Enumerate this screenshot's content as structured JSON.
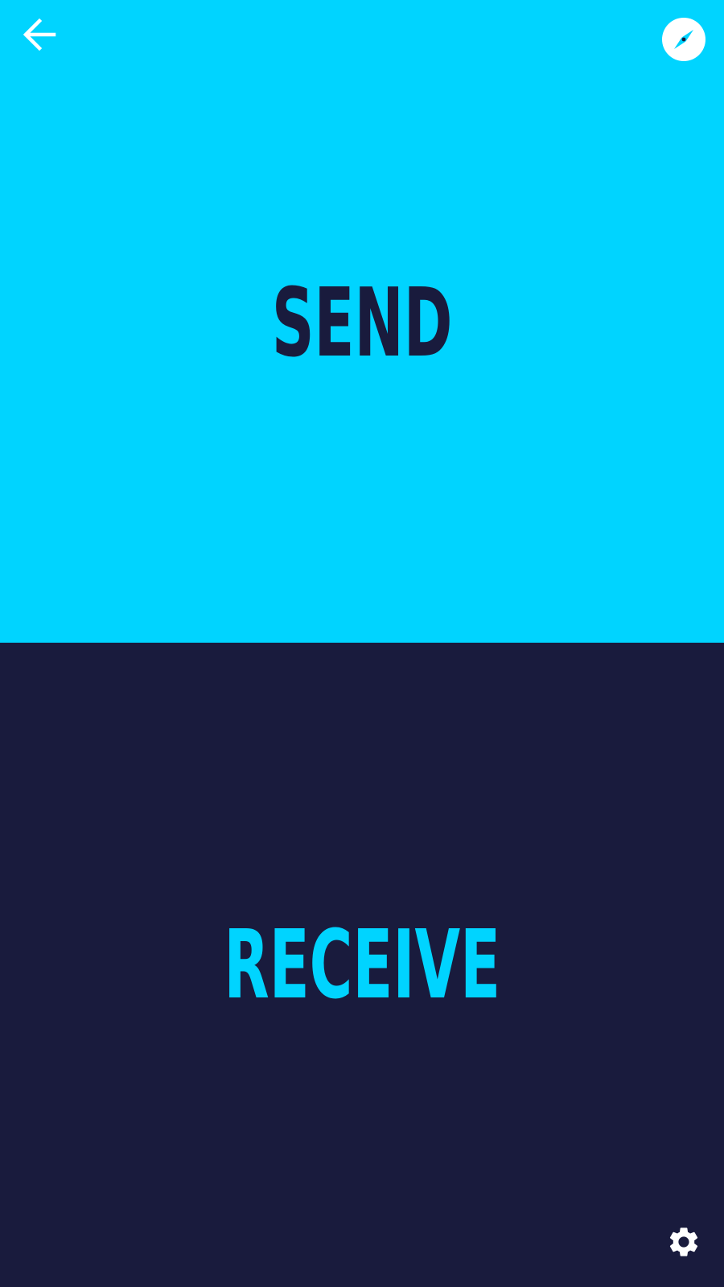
{
  "colors": {
    "send_background": "#00d4ff",
    "send_text": "#191b3d",
    "receive_background": "#191b3d",
    "receive_text": "#00d4ff",
    "icon_light": "#ffffff"
  },
  "send_panel": {
    "label": "SEND"
  },
  "receive_panel": {
    "label": "RECEIVE"
  },
  "icons": {
    "back": "arrow-left-icon",
    "compass": "compass-icon",
    "settings": "gear-icon"
  }
}
